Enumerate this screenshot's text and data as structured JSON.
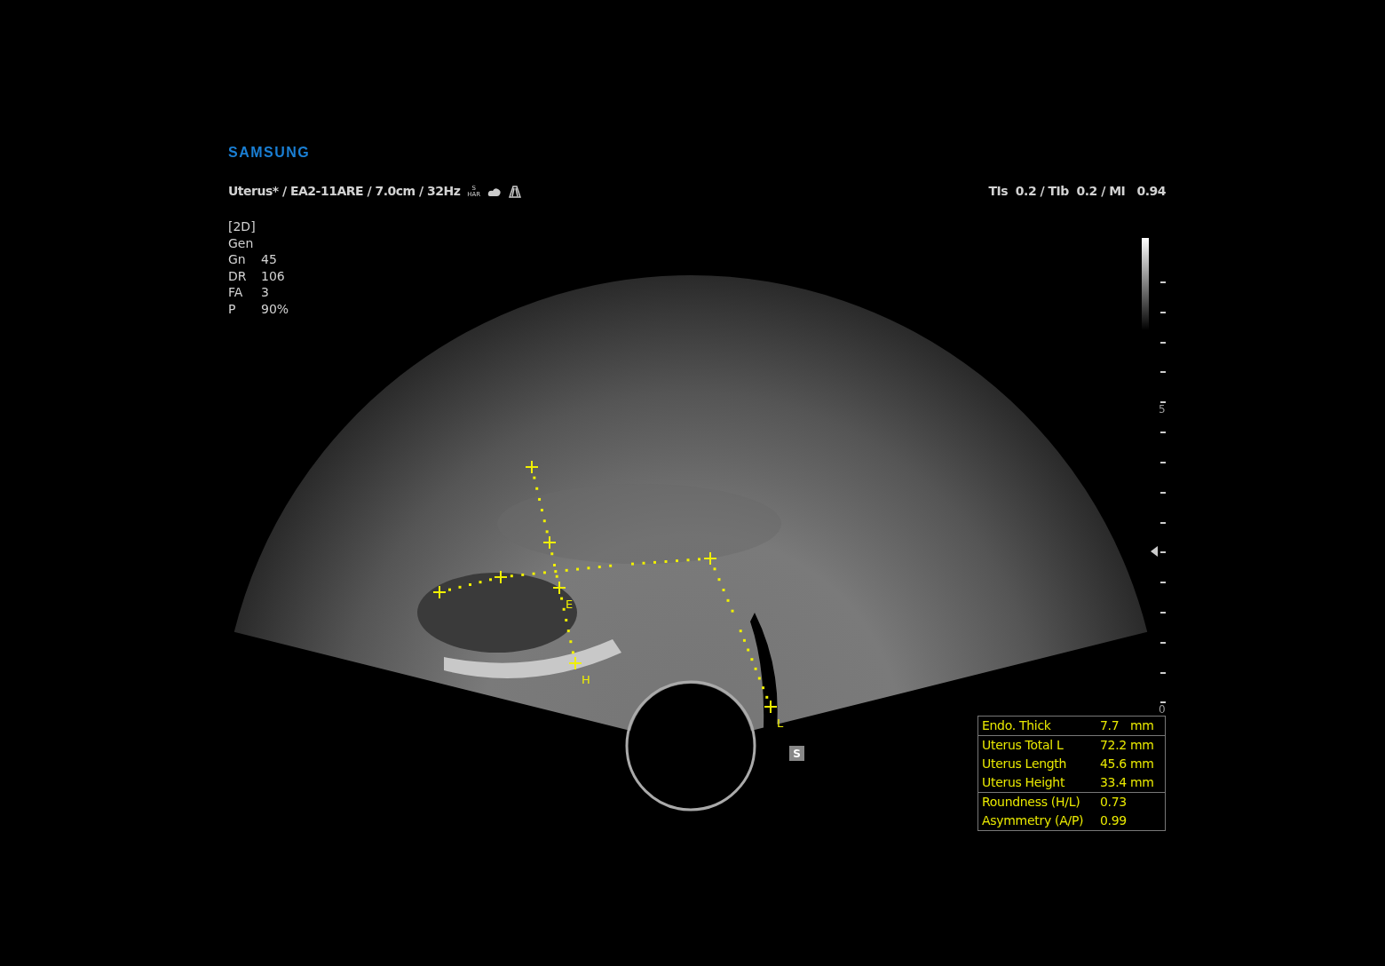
{
  "brand": "SAMSUNG",
  "header": {
    "preset_line": "Uterus* / EA2-11ARE / 7.0cm / 32Hz",
    "harmonic_badge": {
      "top": "S",
      "bottom": "HAR"
    },
    "safety": "TIs  0.2 / TIb  0.2 / MI   0.94"
  },
  "params": {
    "mode": "[2D]",
    "preset": "Gen",
    "rows": [
      {
        "label": "Gn",
        "value": "45"
      },
      {
        "label": "DR",
        "value": "106"
      },
      {
        "label": "FA",
        "value": "3"
      },
      {
        "label": "P",
        "value": "90%"
      }
    ]
  },
  "caliper_labels": [
    "E",
    "H",
    "L"
  ],
  "depth_scale": {
    "labels": [
      "5",
      "0"
    ]
  },
  "orientation_marker": "S",
  "measurements": [
    [
      {
        "name": "Endo. Thick",
        "value": "7.7",
        "unit": "mm"
      }
    ],
    [
      {
        "name": "Uterus Total L",
        "value": "72.2",
        "unit": "mm"
      },
      {
        "name": "Uterus Length",
        "value": "45.6",
        "unit": "mm"
      },
      {
        "name": "Uterus Height",
        "value": "33.4",
        "unit": "mm"
      }
    ],
    [
      {
        "name": "Roundness (H/L)",
        "value": "0.73"
      },
      {
        "name": "Asymmetry (A/P)",
        "value": "0.99"
      }
    ]
  ]
}
